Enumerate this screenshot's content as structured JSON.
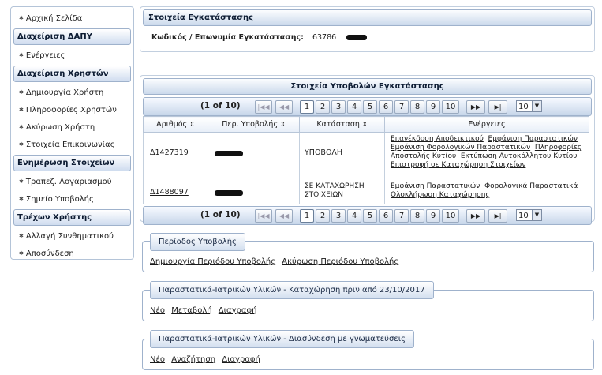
{
  "sidebar": {
    "home": "Αρχική Σελίδα",
    "sections": [
      {
        "title": "Διαχείριση ΔΑΠΥ",
        "items": [
          "Ενέργειες"
        ]
      },
      {
        "title": "Διαχείριση Χρηστών",
        "items": [
          "Δημιουργία Χρήστη",
          "Πληροφορίες Χρηστών",
          "Ακύρωση Χρήστη",
          "Στοιχεία Επικοινωνίας"
        ]
      },
      {
        "title": "Ενημέρωση Στοιχείων",
        "items": [
          "Τραπεζ. Λογαριασμού",
          "Σημείο Υποβολής"
        ]
      },
      {
        "title": "Τρέχων Χρήστης",
        "items": [
          "Αλλαγή Συνθηματικού",
          "Αποσύνδεση"
        ]
      }
    ]
  },
  "install": {
    "title": "Στοιχεία Εγκατάστασης",
    "label": "Κωδικός / Επωνυμία Εγκατάστασης:",
    "code": "63786"
  },
  "submissions": {
    "title": "Στοιχεία Υποβολών Εγκατάστασης",
    "page_info": "(1 of 10)",
    "pages": [
      "1",
      "2",
      "3",
      "4",
      "5",
      "6",
      "7",
      "8",
      "9",
      "10"
    ],
    "rows_per_page": "10",
    "columns": [
      "Αριθμός",
      "Περ. Υποβολής",
      "Κατάσταση",
      "Ενέργειες"
    ],
    "rows": [
      {
        "number": "Δ1427319",
        "status": "ΥΠΟΒΟΛΗ",
        "actions": [
          "Επανέκδοση Αποδεικτικού",
          "Εμφάνιση Παραστατικών",
          "Εμφάνιση Φορολογικών Παραστατικών",
          "Πληροφορίες",
          "Αποστολής Κυτίου",
          "Εκτύπωση Αυτοκόλλητου Κυτίου",
          "Επιστροφή σε Καταχώρηση Στοιχείων"
        ]
      },
      {
        "number": "Δ1488097",
        "status": "ΣΕ ΚΑΤΑΧΩΡΗΣΗ ΣΤΟΙΧΕΙΩΝ",
        "actions": [
          "Εμφάνιση Παραστατικών",
          "Φορολογικά Παραστατικά",
          "Ολοκλήρωση Καταχώρησης"
        ]
      }
    ]
  },
  "period": {
    "legend": "Περίοδος Υποβολής",
    "links": [
      "Δημιουργία Περιόδου Υποβολής",
      "Ακύρωση Περιόδου Υποβολής"
    ]
  },
  "docs_before": {
    "legend": "Παραστατικά-Ιατρικών Υλικών - Καταχώρηση πριν από 23/10/2017",
    "links": [
      "Νέο",
      "Μεταβολή",
      "Διαγραφή"
    ]
  },
  "docs_link": {
    "legend": "Παραστατικά-Ιατρικών Υλικών - Διασύνδεση με γνωματεύσεις",
    "links": [
      "Νέο",
      "Αναζήτηση",
      "Διαγραφή"
    ]
  },
  "icons": {
    "bullet": "gear-bullet-icon",
    "first": "first-page-icon",
    "prev": "prev-page-icon",
    "next": "next-page-icon",
    "last": "last-page-icon",
    "sort": "sort-icon",
    "dropdown": "chevron-down-icon"
  }
}
